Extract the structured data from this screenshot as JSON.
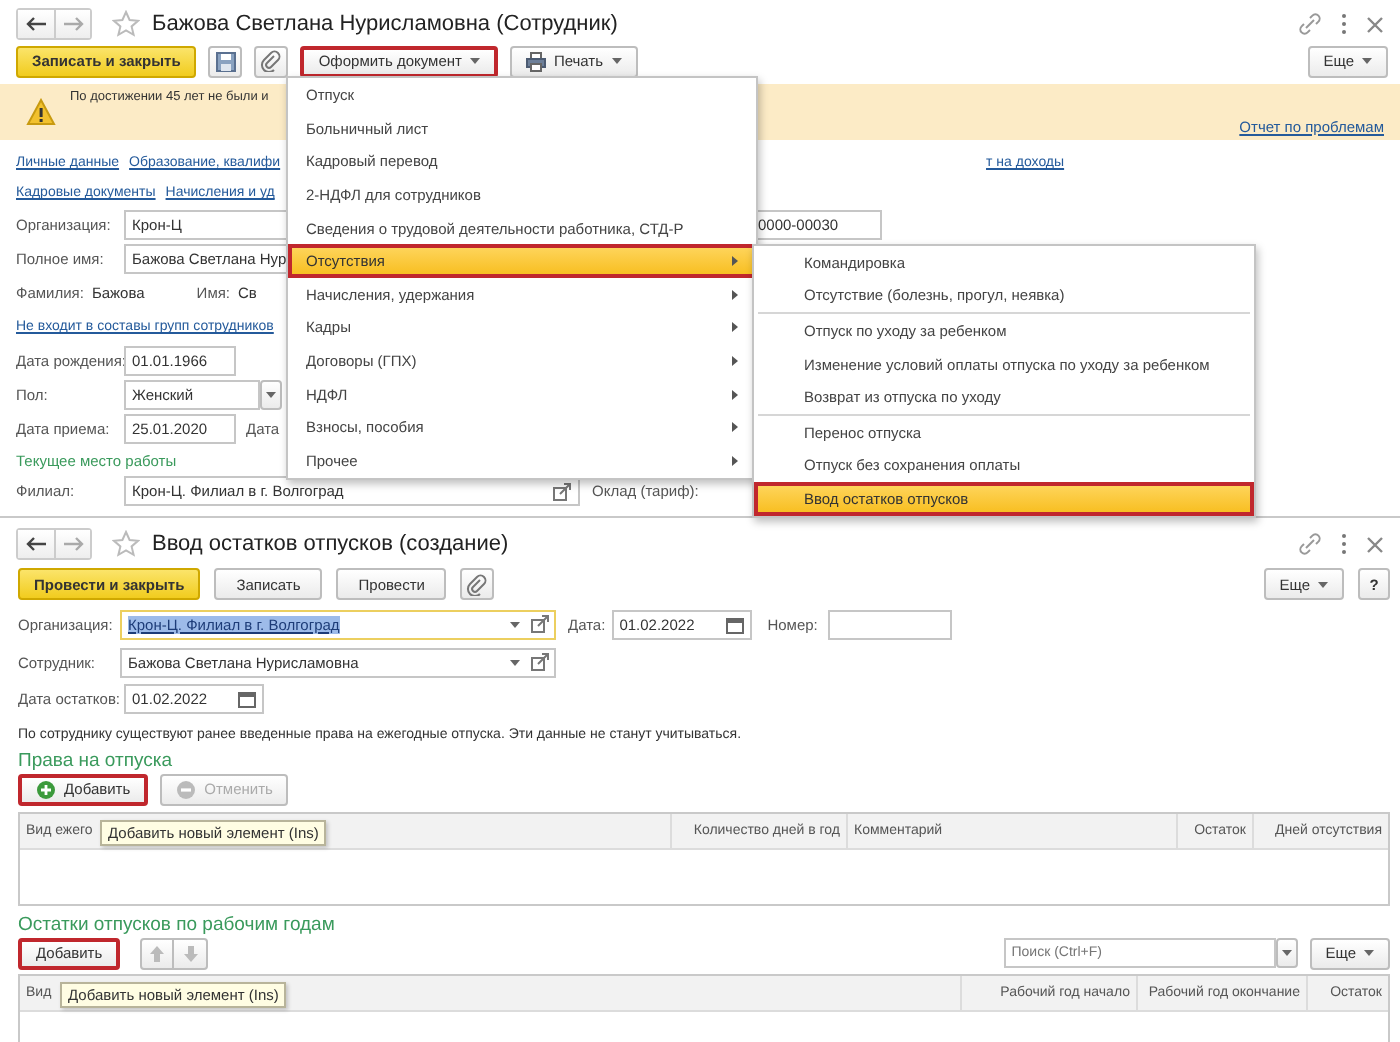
{
  "employee_card": {
    "title": "Бажова Светлана Нурисламовна (Сотрудник)",
    "toolbar": {
      "primary": "Записать и закрыть",
      "menu_buttons": [
        {
          "label": "Оформить документ",
          "kind": "plain",
          "highlighted": true
        },
        {
          "label": "Печать",
          "kind": "print",
          "highlighted": false
        }
      ],
      "more": "Еще"
    },
    "warning": {
      "text": "По достижении 45 лет не были и",
      "link": "Отчет по проблемам"
    },
    "link_rows": [
      [
        "Личные данные",
        "Образование, квалифи"
      ],
      [
        "Кадровые документы",
        "Начисления и уд"
      ]
    ],
    "income_link": "т на доходы",
    "organization": {
      "label": "Организация:",
      "value": "Крон-Ц"
    },
    "number_value": "0000-00030",
    "full_name": {
      "label": "Полное имя:",
      "value": "Бажова Светлана Нур"
    },
    "surname": {
      "label": "Фамилия:",
      "value": "Бажова"
    },
    "first_name": {
      "label": "Имя:",
      "value": "Св"
    },
    "groups_link": "Не входит в составы групп сотрудников",
    "birth_date": {
      "label": "Дата рождения:",
      "value": "01.01.1966"
    },
    "gender": {
      "label": "Пол:",
      "value": "Женский"
    },
    "hire_date": {
      "label": "Дата приема:",
      "value": "25.01.2020"
    },
    "hire_next_label": "Дата",
    "workplace_heading": "Текущее место работы",
    "branch": {
      "label": "Филиал:",
      "value": "Крон-Ц. Филиал в г. Волгоград"
    },
    "salary_label": "Оклад (тариф):"
  },
  "document_menu": {
    "items": [
      {
        "label": "Отпуск",
        "has_submenu": false,
        "selected": false
      },
      {
        "label": "Больничный лист",
        "has_submenu": false,
        "selected": false
      },
      {
        "label": "Кадровый перевод",
        "has_submenu": false,
        "selected": false
      },
      {
        "label": "2-НДФЛ для сотрудников",
        "has_submenu": false,
        "selected": false
      },
      {
        "label": "Сведения о трудовой деятельности работника, СТД-Р",
        "has_submenu": false,
        "selected": false
      },
      {
        "label": "Отсутствия",
        "has_submenu": true,
        "selected": true
      },
      {
        "label": "Начисления, удержания",
        "has_submenu": true,
        "selected": false
      },
      {
        "label": "Кадры",
        "has_submenu": true,
        "selected": false
      },
      {
        "label": "Договоры (ГПХ)",
        "has_submenu": true,
        "selected": false
      },
      {
        "label": "НДФЛ",
        "has_submenu": true,
        "selected": false
      },
      {
        "label": "Взносы, пособия",
        "has_submenu": true,
        "selected": false
      },
      {
        "label": "Прочее",
        "has_submenu": true,
        "selected": false
      }
    ]
  },
  "absences_submenu": {
    "groups": [
      [
        {
          "label": "Командировка",
          "selected": false
        },
        {
          "label": "Отсутствие (болезнь, прогул, неявка)",
          "selected": false
        }
      ],
      [
        {
          "label": "Отпуск по уходу за ребенком",
          "selected": false
        },
        {
          "label": "Изменение условий оплаты отпуска по уходу за ребенком",
          "selected": false
        },
        {
          "label": "Возврат из отпуска по уходу",
          "selected": false
        }
      ],
      [
        {
          "label": "Перенос отпуска",
          "selected": false
        },
        {
          "label": "Отпуск без сохранения оплаты",
          "selected": false
        },
        {
          "label": "Ввод остатков отпусков",
          "selected": true
        }
      ]
    ]
  },
  "balance_document": {
    "title": "Ввод остатков отпусков (создание)",
    "toolbar": [
      {
        "label": "Провести и закрыть",
        "kind": "primary"
      },
      {
        "label": "Записать",
        "kind": "normal"
      },
      {
        "label": "Провести",
        "kind": "normal"
      }
    ],
    "more": "Еще",
    "help": "?",
    "organization": {
      "label": "Организация:",
      "value": "Крон-Ц. Филиал в г. Волгоград",
      "text_selected": true
    },
    "date": {
      "label": "Дата:",
      "value": "01.02.2022"
    },
    "number": {
      "label": "Номер:"
    },
    "employee": {
      "label": "Сотрудник:",
      "value": "Бажова Светлана Нурисламовна"
    },
    "balance_date": {
      "label": "Дата остатков:",
      "value": "01.02.2022"
    },
    "note": "По сотруднику существуют ранее введенные права на ежегодные отпуска. Эти данные не станут учитываться.",
    "entitlements": {
      "heading": "Права на отпуска",
      "buttons": [
        {
          "label": "Добавить",
          "kind": "add",
          "highlighted": true,
          "disabled": false
        },
        {
          "label": "Отменить",
          "kind": "cancel",
          "highlighted": false,
          "disabled": true
        }
      ],
      "tooltip": "Добавить новый элемент (Ins)",
      "columns": [
        "Вид ежего",
        "Количество дней в год",
        "Комментарий",
        "Остаток",
        "Дней отсутствия"
      ]
    },
    "balances": {
      "heading": "Остатки отпусков по рабочим годам",
      "buttons": [
        {
          "label": "Добавить",
          "kind": "plain",
          "highlighted": true,
          "disabled": false
        }
      ],
      "search": {
        "placeholder": "Поиск (Ctrl+F)"
      },
      "more": "Еще",
      "tooltip": "Добавить новый элемент (Ins)",
      "columns": [
        "Вид",
        "Рабочий год начало",
        "Рабочий год окончание",
        "Остаток"
      ]
    }
  }
}
